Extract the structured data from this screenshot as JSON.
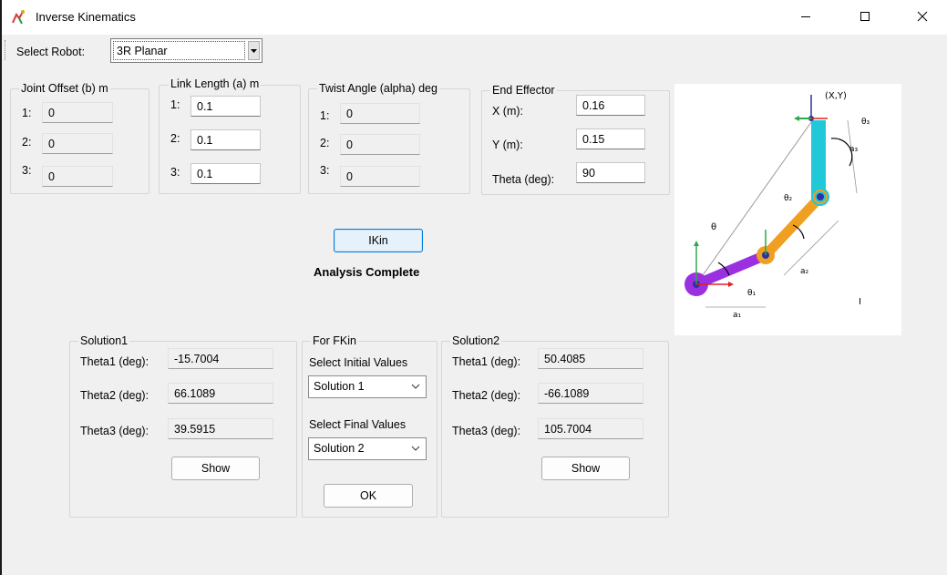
{
  "window": {
    "title": "Inverse Kinematics"
  },
  "toolbar": {
    "select_robot_label": "Select Robot:",
    "robot_value": "3R Planar"
  },
  "joint_offset": {
    "legend": "Joint Offset (b) m",
    "rows": [
      {
        "label": "1:",
        "value": "0"
      },
      {
        "label": "2:",
        "value": "0"
      },
      {
        "label": "3:",
        "value": "0"
      }
    ]
  },
  "link_length": {
    "legend": "Link Length (a) m",
    "rows": [
      {
        "label": "1:",
        "value": "0.1"
      },
      {
        "label": "2:",
        "value": "0.1"
      },
      {
        "label": "3:",
        "value": "0.1"
      }
    ]
  },
  "twist_angle": {
    "legend": "Twist Angle (alpha) deg",
    "rows": [
      {
        "label": "1:",
        "value": "0"
      },
      {
        "label": "2:",
        "value": "0"
      },
      {
        "label": "3:",
        "value": "0"
      }
    ]
  },
  "end_effector": {
    "legend": "End Effector",
    "x_label": "X (m):",
    "x_value": "0.16",
    "y_label": "Y (m):",
    "y_value": "0.15",
    "theta_label": "Theta (deg):",
    "theta_value": "90"
  },
  "ikin_button": "IKin",
  "status": "Analysis Complete",
  "solution1": {
    "legend": "Solution1",
    "rows": [
      {
        "label": "Theta1 (deg):",
        "value": "-15.7004"
      },
      {
        "label": "Theta2 (deg):",
        "value": "66.1089"
      },
      {
        "label": "Theta3 (deg):",
        "value": "39.5915"
      }
    ],
    "show_button": "Show"
  },
  "fkin": {
    "legend": "For FKin",
    "initial_label": "Select Initial Values",
    "initial_value": "Solution 1",
    "final_label": "Select Final Values",
    "final_value": "Solution 2",
    "ok_button": "OK"
  },
  "solution2": {
    "legend": "Solution2",
    "rows": [
      {
        "label": "Theta1 (deg):",
        "value": "50.4085"
      },
      {
        "label": "Theta2 (deg):",
        "value": "-66.1089"
      },
      {
        "label": "Theta3 (deg):",
        "value": "105.7004"
      }
    ],
    "show_button": "Show"
  },
  "diagram": {
    "xy_label": "(X,Y)",
    "theta": "θ",
    "theta1": "θ₁",
    "theta2": "θ₂",
    "theta3": "θ₃",
    "a1": "a₁",
    "a2": "a₂",
    "a3": "a₃",
    "marker": "I"
  },
  "colors": {
    "link1": "#9b30e0",
    "link2": "#f0a020",
    "link3": "#20c8d8",
    "accent": "#0078d7"
  }
}
